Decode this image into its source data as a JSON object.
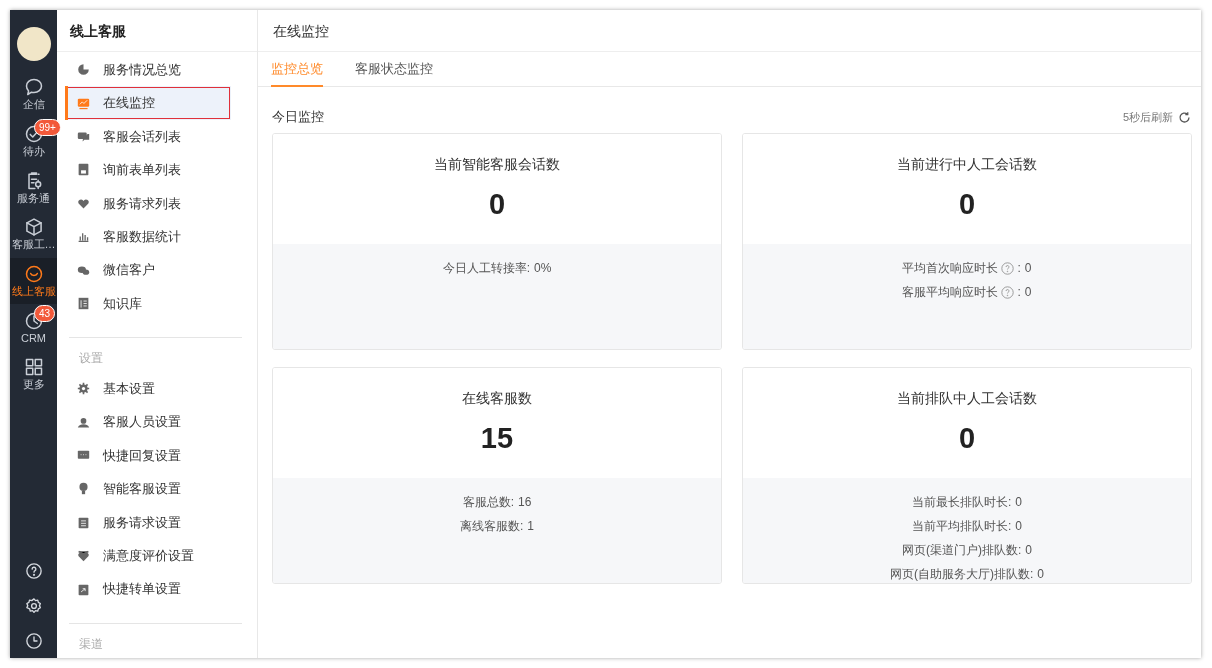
{
  "rail": {
    "items": [
      {
        "label": "企信",
        "selected": false
      },
      {
        "label": "待办",
        "selected": false,
        "badge": "99+"
      },
      {
        "label": "服务通",
        "selected": false
      },
      {
        "label": "客服工…",
        "selected": false
      },
      {
        "label": "线上客服",
        "selected": true
      },
      {
        "label": "CRM",
        "selected": false,
        "badge": "43"
      },
      {
        "label": "更多",
        "selected": false
      }
    ]
  },
  "sidebar": {
    "title": "线上客服",
    "items": [
      {
        "label": "服务情况总览",
        "selected": false
      },
      {
        "label": "在线监控",
        "selected": true,
        "annotated": true
      },
      {
        "label": "客服会话列表",
        "selected": false
      },
      {
        "label": "询前表单列表",
        "selected": false
      },
      {
        "label": "服务请求列表",
        "selected": false
      },
      {
        "label": "客服数据统计",
        "selected": false
      },
      {
        "label": "微信客户",
        "selected": false
      },
      {
        "label": "知识库",
        "selected": false
      }
    ],
    "sections": [
      {
        "title": "设置",
        "items": [
          {
            "label": "基本设置",
            "selected": false
          },
          {
            "label": "客服人员设置",
            "selected": false
          },
          {
            "label": "快捷回复设置",
            "selected": false
          },
          {
            "label": "智能客服设置",
            "selected": false
          },
          {
            "label": "服务请求设置",
            "selected": false
          },
          {
            "label": "满意度评价设置",
            "selected": false
          },
          {
            "label": "快捷转单设置",
            "selected": false
          }
        ]
      },
      {
        "title": "渠道"
      }
    ]
  },
  "main": {
    "title": "在线监控",
    "tabs": [
      {
        "label": "监控总览",
        "selected": true
      },
      {
        "label": "客服状态监控",
        "selected": false
      }
    ],
    "section_title": "今日监控",
    "refresh": "5秒后刷新",
    "cards": [
      {
        "title": "当前智能客服会话数",
        "value": "0",
        "stats": [
          {
            "label": "今日人工转接率:",
            "value": "0%",
            "help": false
          }
        ]
      },
      {
        "title": "当前进行中人工会话数",
        "value": "0",
        "stats": [
          {
            "label": "平均首次响应时长",
            "colon": ":",
            "value": "0",
            "help": true
          },
          {
            "label": "客服平均响应时长",
            "colon": ":",
            "value": "0",
            "help": true
          }
        ]
      },
      {
        "title": "在线客服数",
        "value": "15",
        "stats": [
          {
            "label": "客服总数:",
            "value": "16",
            "help": false
          },
          {
            "label": "离线客服数:",
            "value": "1",
            "help": false
          }
        ]
      },
      {
        "title": "当前排队中人工会话数",
        "value": "0",
        "scroll": true,
        "stats": [
          {
            "label": "当前最长排队时长:",
            "value": "0",
            "help": false
          },
          {
            "label": "当前平均排队时长:",
            "value": "0",
            "help": false
          },
          {
            "label": "网页(渠道门户)排队数:",
            "value": "0",
            "help": false
          },
          {
            "label": "网页(自助服务大厅)排队数:",
            "value": "0",
            "help": false
          }
        ]
      }
    ]
  }
}
